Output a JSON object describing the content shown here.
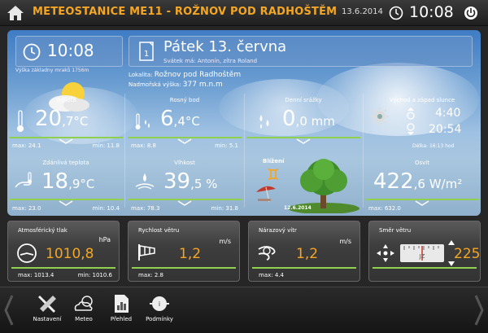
{
  "header": {
    "title": "METEOSTANICE ME11 - ROŽNOV POD RADHOŠTĚM",
    "date": "13.6.2014",
    "time": "10:08"
  },
  "main": {
    "time": "10:08",
    "cloud_base": "Výška základny mraků 1756m",
    "date": "Pátek 13. června",
    "nameday": "Svátek má: Antonín, zítra Roland",
    "location_label": "Lokalita:",
    "location": "Rožnov pod Radhoštěm",
    "altitude_label": "Nadmořská výška:",
    "altitude": "377 m.n.m"
  },
  "tiles": {
    "temperature": {
      "label": "Teplota",
      "int": "20",
      "dec": ",7",
      "unit": "°C",
      "max": "max: 24.1",
      "min": "min: 11.8"
    },
    "dewpoint": {
      "label": "Rosný bod",
      "int": "6",
      "dec": ",4",
      "unit": "°C",
      "max": "max: 8.8",
      "min": "min: 5.1"
    },
    "rain": {
      "label": "Denní srážky",
      "int": "0",
      "dec": ",0",
      "unit": " mm"
    },
    "sun": {
      "label": "Východ a západ slunce",
      "sunrise": "4:40",
      "sunset": "20:54",
      "daylength": "Délka: 16:13 hod"
    },
    "feels": {
      "label": "Zdánlivá teplota",
      "int": "18",
      "dec": ",9",
      "unit": "°C",
      "max": "max: 23.0",
      "min": "min: 10.4"
    },
    "humidity": {
      "label": "Vlhkost",
      "int": "39",
      "dec": ",5",
      "unit": " %",
      "max": "max: 78.3",
      "min": "min: 31.8"
    },
    "season": {
      "label": "Blížení",
      "date": "12.6.2014"
    },
    "light": {
      "label": "Osvit",
      "int": "422",
      "dec": ",6",
      "unit": " W/m²",
      "max": "max: 632.0"
    }
  },
  "cards": {
    "pressure": {
      "label": "Atmosférický tlak",
      "unit": "hPa",
      "value": "1010,8",
      "max": "max: 1013.4",
      "min": "min: 1010.6"
    },
    "wind": {
      "label": "Rychlost větru",
      "unit": "m/s",
      "value": "1,2",
      "max": "max: 2.8"
    },
    "gust": {
      "label": "Nárazový vítr",
      "unit": "m/s",
      "value": "1,2",
      "max": "max: 4.4"
    },
    "direction": {
      "label": "Směr větru",
      "value": "225"
    }
  },
  "nav": {
    "items": [
      {
        "label": "Nastavení",
        "icon": "tools-icon"
      },
      {
        "label": "Meteo",
        "icon": "cloud-icon"
      },
      {
        "label": "Přehled",
        "icon": "chart-doc-icon"
      },
      {
        "label": "Podmínky",
        "icon": "conditions-icon"
      }
    ]
  },
  "colors": {
    "accent": "#f5a623",
    "bar": "#8fd14f"
  }
}
